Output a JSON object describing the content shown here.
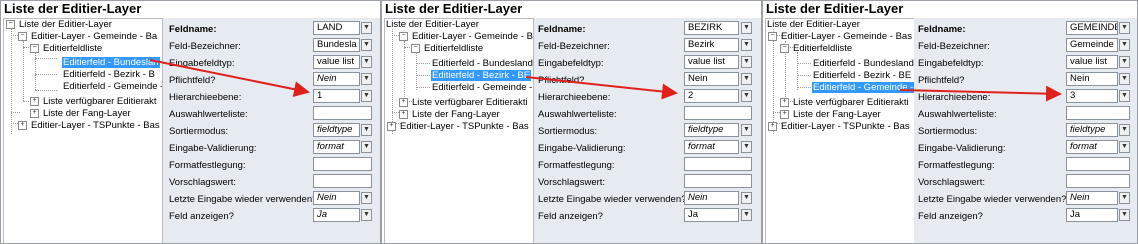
{
  "panels": [
    {
      "title": "Liste der Editier-Layer",
      "tree": {
        "root": "Liste der Editier-Layer",
        "layer_gemeinde": "Editier-Layer - Gemeinde - Ba",
        "feldliste": "Editierfeldliste",
        "items": [
          "Editierfeld - Bundeslan",
          "Editierfeld - Bezirk - B",
          "Editierfeld - Gemeinde -"
        ],
        "selected_index": 0,
        "verfuegbar": "Liste verfügbarer Editierakt",
        "fang": "Liste der Fang-Layer",
        "layer_tspunkte": "Editier-Layer - TSPunkte - Bas"
      },
      "fields": {
        "feldname": "LAND",
        "bezeichner": "Bundesla",
        "eingabefeldtyp": "value list",
        "pflichtfeld": "Nein",
        "hierarchieebene": "1",
        "auswahlwerteliste": "",
        "sortiermodus": "fieldtype",
        "validierung": "format",
        "formatfestlegung": "",
        "vorschlagswert": "",
        "letzte_eingabe": "Nein",
        "anzeigen": "Ja"
      }
    },
    {
      "title": "Liste der Editier-Layer",
      "tree": {
        "root": "Liste der Editier-Layer",
        "layer_gemeinde": "Editier-Layer - Gemeinde - Bas",
        "feldliste": "Editierfeldliste",
        "items": [
          "Editierfeld - Bundesland",
          "Editierfeld - Bezirk - BE",
          "Editierfeld - Gemeinde -"
        ],
        "selected_index": 1,
        "verfuegbar": "Liste verfügbarer Editierakti",
        "fang": "Liste der Fang-Layer",
        "layer_tspunkte": "Editier-Layer - TSPunkte - Bas"
      },
      "fields": {
        "feldname": "BEZIRK",
        "bezeichner": "Bezirk",
        "eingabefeldtyp": "value list",
        "pflichtfeld": "Nein",
        "hierarchieebene": "2",
        "auswahlwerteliste": "",
        "sortiermodus": "fieldtype",
        "validierung": "format",
        "formatfestlegung": "",
        "vorschlagswert": "",
        "letzte_eingabe": "Nein",
        "anzeigen": "Ja"
      }
    },
    {
      "title": "Liste der Editier-Layer",
      "tree": {
        "root": "Liste der Editier-Layer",
        "layer_gemeinde": "Editier-Layer - Gemeinde - Bas",
        "feldliste": "Editierfeldliste",
        "items": [
          "Editierfeld - Bundesland",
          "Editierfeld - Bezirk - BE",
          "Editierfeld - Gemeinde -"
        ],
        "selected_index": 2,
        "verfuegbar": "Liste verfügbarer Editierakti",
        "fang": "Liste der Fang-Layer",
        "layer_tspunkte": "Editier-Layer - TSPunkte - Bas"
      },
      "fields": {
        "feldname": "GEMEINDE",
        "bezeichner": "Gemeinde",
        "eingabefeldtyp": "value list",
        "pflichtfeld": "Nein",
        "hierarchieebene": "3",
        "auswahlwerteliste": "",
        "sortiermodus": "fieldtype",
        "validierung": "format",
        "formatfestlegung": "",
        "vorschlagswert": "",
        "letzte_eingabe": "Nein",
        "anzeigen": "Ja"
      }
    }
  ],
  "labels": {
    "feldname": "Feldname:",
    "bezeichner": "Feld-Bezeichner:",
    "eingabefeldtyp": "Eingabefeldtyp:",
    "pflichtfeld": "Pflichtfeld?",
    "hierarchieebene": "Hierarchieebene:",
    "auswahlwerteliste": "Auswahlwerteliste:",
    "sortiermodus": "Sortiermodus:",
    "validierung": "Eingabe-Validierung:",
    "formatfestlegung": "Formatfestlegung:",
    "vorschlagswert": "Vorschlagswert:",
    "letzte_eingabe": "Letzte Eingabe wieder verwenden?",
    "anzeigen": "Feld anzeigen?"
  },
  "icons": {
    "expanded": "minus-box-icon",
    "collapsed": "plus-box-icon",
    "dropdown": "dropdown-arrow-icon",
    "annotation": "red-arrow-icon"
  },
  "colors": {
    "selection": "#3399ff",
    "props_background": "#e6ebf2",
    "annotation_arrow": "#e0201b"
  }
}
